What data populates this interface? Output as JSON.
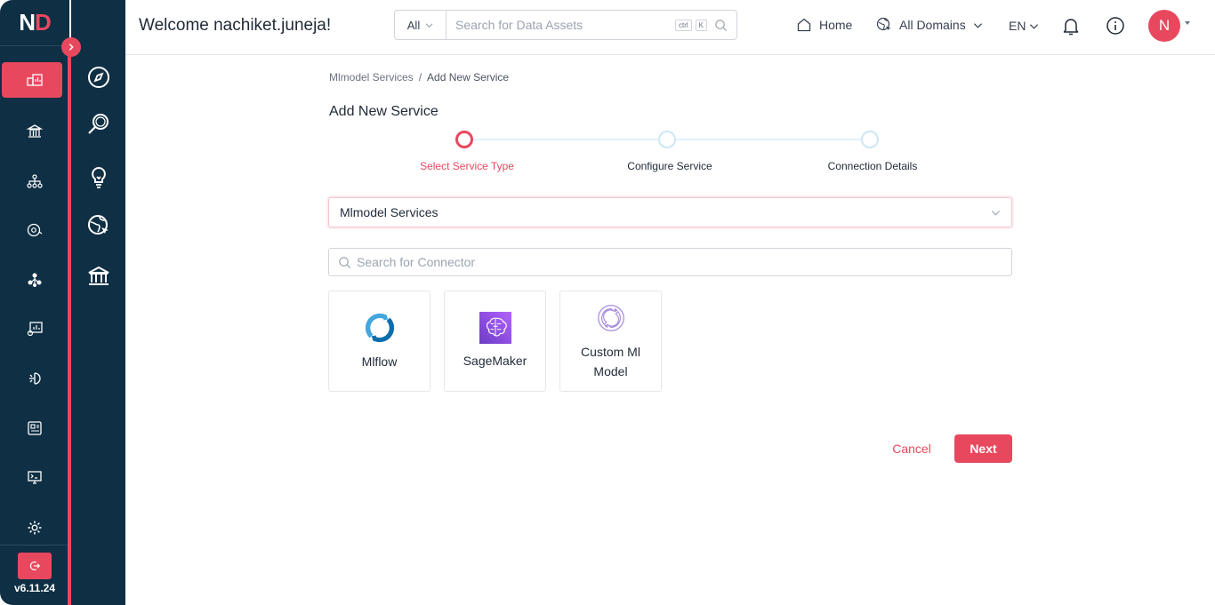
{
  "brand": {
    "logo_n": "N",
    "logo_d": "D",
    "accent": "#e8485e",
    "sidebar_bg": "#0f2f44"
  },
  "sidebar": {
    "items": [
      {
        "icon": "dashboard-icon",
        "active": true
      },
      {
        "icon": "governance-icon",
        "active": false
      },
      {
        "icon": "hierarchy-icon",
        "active": false
      },
      {
        "icon": "observability-icon",
        "active": false
      },
      {
        "icon": "lineage-icon",
        "active": false
      },
      {
        "icon": "insights-icon",
        "active": false
      },
      {
        "icon": "data-quality-icon",
        "active": false
      },
      {
        "icon": "glossary-icon",
        "active": false
      },
      {
        "icon": "monitor-icon",
        "active": false
      },
      {
        "icon": "settings-icon",
        "active": false
      }
    ],
    "version": "v6.11.24"
  },
  "subnav": {
    "items": [
      {
        "icon": "explore-icon"
      },
      {
        "icon": "data-search-icon"
      },
      {
        "icon": "lightbulb-icon"
      },
      {
        "icon": "domain-globe-icon"
      },
      {
        "icon": "bank-icon"
      }
    ]
  },
  "header": {
    "welcome": "Welcome nachiket.juneja!",
    "search_type": "All",
    "search_placeholder": "Search for Data Assets",
    "kbd_ctrl": "ctrl",
    "kbd_k": "K",
    "home": "Home",
    "domains": "All Domains",
    "lang": "EN",
    "avatar_initial": "N"
  },
  "breadcrumb": {
    "parent": "Mlmodel Services",
    "separator": "/",
    "current": "Add New Service"
  },
  "page": {
    "title": "Add New Service"
  },
  "steps": [
    {
      "label": "Select Service Type",
      "active": true
    },
    {
      "label": "Configure Service",
      "active": false
    },
    {
      "label": "Connection Details",
      "active": false
    }
  ],
  "service_type": {
    "selected": "Mlmodel Services"
  },
  "connector_search": {
    "placeholder": "Search for Connector"
  },
  "connectors": [
    {
      "label": "Mlflow",
      "icon": "mlflow-icon"
    },
    {
      "label": "SageMaker",
      "icon": "sagemaker-icon"
    },
    {
      "label": "Custom Ml Model",
      "icon": "custom-model-icon"
    }
  ],
  "actions": {
    "cancel": "Cancel",
    "next": "Next"
  }
}
